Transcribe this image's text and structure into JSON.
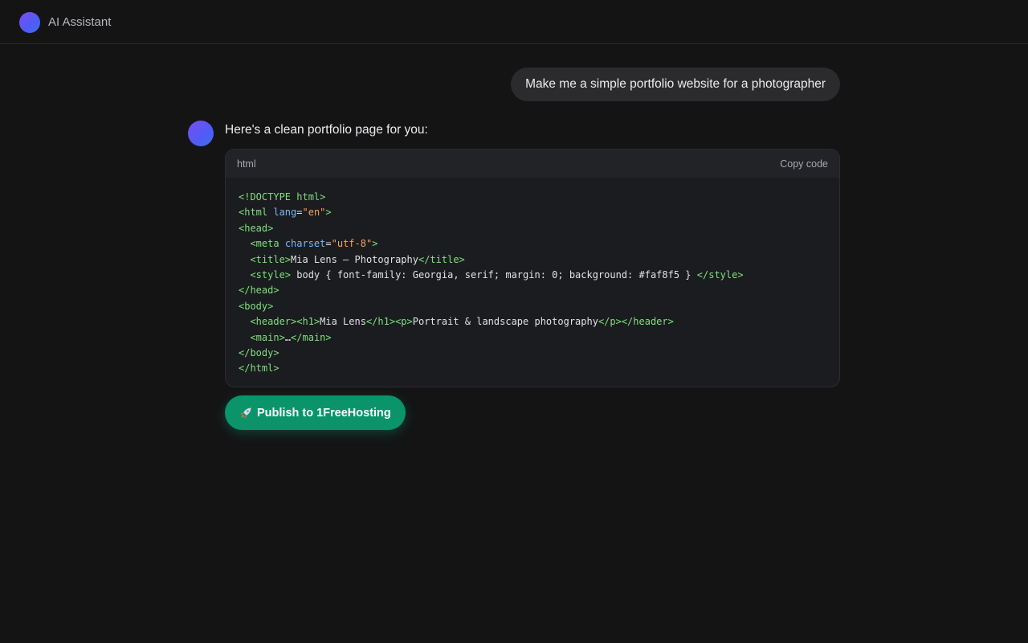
{
  "app": {
    "title": "AI Assistant"
  },
  "conversation": {
    "user_message": "Make me a simple portfolio website for a photographer",
    "assistant_intro": "Here's a clean portfolio page for you:"
  },
  "code_block": {
    "language": "html",
    "copy_label": "Copy code",
    "lines": [
      [
        {
          "t": "tag",
          "v": "<!DOCTYPE html>"
        }
      ],
      [
        {
          "t": "tag",
          "v": "<html "
        },
        {
          "t": "attr",
          "v": "lang"
        },
        {
          "t": "txt",
          "v": "="
        },
        {
          "t": "str",
          "v": "\"en\""
        },
        {
          "t": "tag",
          "v": ">"
        }
      ],
      [
        {
          "t": "tag",
          "v": "<head>"
        }
      ],
      [
        {
          "t": "txt",
          "v": "  "
        },
        {
          "t": "tag",
          "v": "<meta "
        },
        {
          "t": "attr",
          "v": "charset"
        },
        {
          "t": "txt",
          "v": "="
        },
        {
          "t": "str",
          "v": "\"utf-8\""
        },
        {
          "t": "tag",
          "v": ">"
        }
      ],
      [
        {
          "t": "txt",
          "v": "  "
        },
        {
          "t": "tag",
          "v": "<title>"
        },
        {
          "t": "txt",
          "v": "Mia Lens — Photography"
        },
        {
          "t": "tag",
          "v": "</title>"
        }
      ],
      [
        {
          "t": "txt",
          "v": "  "
        },
        {
          "t": "tag",
          "v": "<style>"
        },
        {
          "t": "txt",
          "v": " body { font-family: Georgia, serif; margin: 0; background: #faf8f5 } "
        },
        {
          "t": "tag",
          "v": "</style>"
        }
      ],
      [
        {
          "t": "tag",
          "v": "</head>"
        }
      ],
      [
        {
          "t": "tag",
          "v": "<body>"
        }
      ],
      [
        {
          "t": "txt",
          "v": "  "
        },
        {
          "t": "tag",
          "v": "<header><h1>"
        },
        {
          "t": "txt",
          "v": "Mia Lens"
        },
        {
          "t": "tag",
          "v": "</h1><p>"
        },
        {
          "t": "txt",
          "v": "Portrait & landscape photography"
        },
        {
          "t": "tag",
          "v": "</p></header>"
        }
      ],
      [
        {
          "t": "txt",
          "v": "  "
        },
        {
          "t": "tag",
          "v": "<main>"
        },
        {
          "t": "txt",
          "v": "…"
        },
        {
          "t": "tag",
          "v": "</main>"
        }
      ],
      [
        {
          "t": "tag",
          "v": "</body>"
        }
      ],
      [
        {
          "t": "tag",
          "v": "</html>"
        }
      ]
    ]
  },
  "actions": {
    "publish_label": "Publish to 1FreeHosting",
    "publish_icon": "rocket-icon"
  },
  "colors": {
    "background": "#141415",
    "accent_green": "#0b9469",
    "avatar_gradient_start": "#7b4df2",
    "avatar_gradient_end": "#3f6cf0",
    "code_tag": "#7ee07e",
    "code_attr": "#7ab8f5",
    "code_string": "#f5a35a"
  }
}
